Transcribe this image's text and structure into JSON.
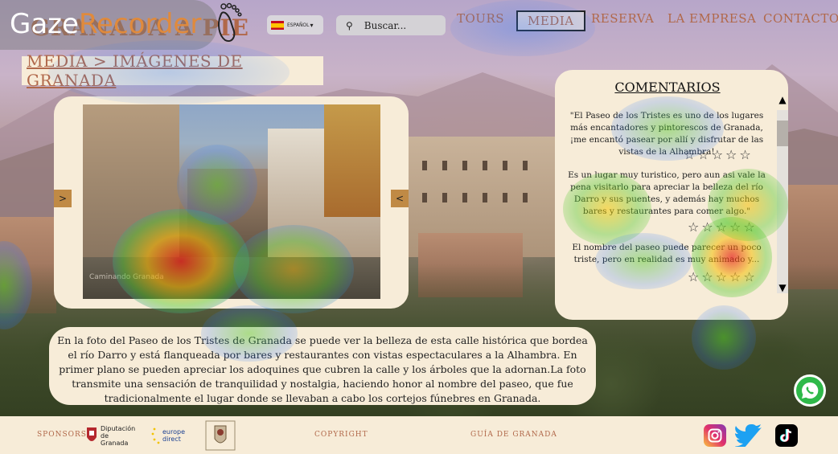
{
  "overlay": {
    "brand_white": "Gaze",
    "brand_orange": "Recorder"
  },
  "header": {
    "logo": "GRANADA A PIE",
    "language": "ESPAÑOL",
    "search_placeholder": "Buscar...",
    "nav": [
      "TOURS",
      "MEDIA",
      "RESERVA",
      "LA EMPRESA",
      "CONTACTO"
    ],
    "active_nav": "MEDIA"
  },
  "breadcrumb": "MEDIA > IMÁGENES DE GRANADA",
  "gallery": {
    "prev_label": ">",
    "next_label": "<",
    "watermark": "Caminando Granada"
  },
  "caption": "En la foto del Paseo de los Tristes de Granada se puede ver la belleza de esta calle histórica que bordea el río Darro y está flanqueada por bares y restaurantes con vistas espectaculares a la Alhambra. En primer plano se pueden apreciar los adoquines que cubren la calle y los árboles que la adornan.La foto transmite una sensación de tranquilidad y nostalgia, haciendo honor al nombre del paseo, que fue tradicionalmente el lugar donde se llevaban a cabo los cortejos fúnebres en Granada.",
  "comments": {
    "title": "COMENTARIOS",
    "items": [
      {
        "text": "\"El Paseo de los Tristes es uno de los lugares más encantadores y pintorescos de Granada, ¡me encantó pasear por allí y disfrutar de las vistas de la Alhambra!",
        "stars": "☆☆☆☆☆"
      },
      {
        "text": "Es un lugar muy turistico, pero aun asi vale la pena visitarlo para apreciar la belleza del río Darro y sus puentes, y además hay muchos bares y restaurantes para comer algo.\"",
        "stars": "☆☆☆☆☆"
      },
      {
        "text": "El nombre del paseo puede parecer un poco triste, pero en realidad es muy animado y...",
        "stars": "☆☆☆☆☆"
      }
    ]
  },
  "footer": {
    "sponsors_label": "SPONSORS",
    "sponsor_1": "Diputación de Granada",
    "sponsor_2": "europe direct",
    "copyright": "COPYRIGHT",
    "guide": "GUÍA DE GRANADA"
  },
  "colors": {
    "accent": "#b1684a",
    "panel": "#f7ecd8"
  },
  "icons": [
    "footprint-icon",
    "search-icon",
    "spain-flag-icon",
    "instagram-icon",
    "twitter-icon",
    "tiktok-icon",
    "whatsapp-icon"
  ]
}
